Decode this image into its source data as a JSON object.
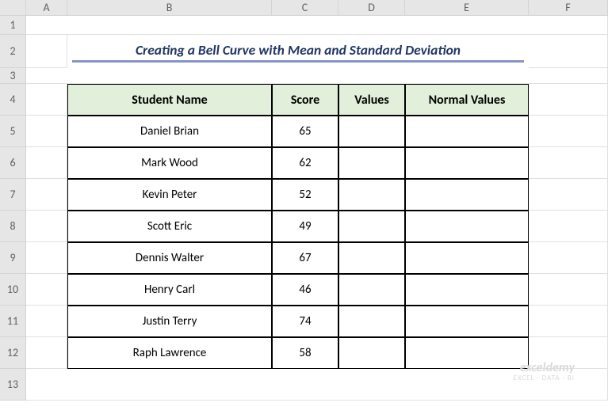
{
  "columns": [
    "A",
    "B",
    "C",
    "D",
    "E",
    "F"
  ],
  "rows": [
    "1",
    "2",
    "3",
    "4",
    "5",
    "6",
    "7",
    "8",
    "9",
    "10",
    "11",
    "12",
    "13"
  ],
  "title": "Creating a Bell Curve with Mean and Standard Deviation",
  "headers": {
    "b": "Student Name",
    "c": "Score",
    "d": "Values",
    "e": "Normal Values"
  },
  "chart_data": {
    "type": "table",
    "columns": [
      "Student Name",
      "Score",
      "Values",
      "Normal Values"
    ],
    "rows": [
      {
        "name": "Daniel Brian",
        "score": 65,
        "values": "",
        "normal": ""
      },
      {
        "name": "Mark Wood",
        "score": 62,
        "values": "",
        "normal": ""
      },
      {
        "name": "Kevin Peter",
        "score": 52,
        "values": "",
        "normal": ""
      },
      {
        "name": "Scott Eric",
        "score": 49,
        "values": "",
        "normal": ""
      },
      {
        "name": "Dennis Walter",
        "score": 67,
        "values": "",
        "normal": ""
      },
      {
        "name": "Henry Carl",
        "score": 46,
        "values": "",
        "normal": ""
      },
      {
        "name": "Justin Terry",
        "score": 74,
        "values": "",
        "normal": ""
      },
      {
        "name": "Raph Lawrence",
        "score": 58,
        "values": "",
        "normal": ""
      }
    ]
  },
  "watermark": {
    "line1": "exceldemy",
    "line2": "EXCEL · DATA · BI"
  }
}
